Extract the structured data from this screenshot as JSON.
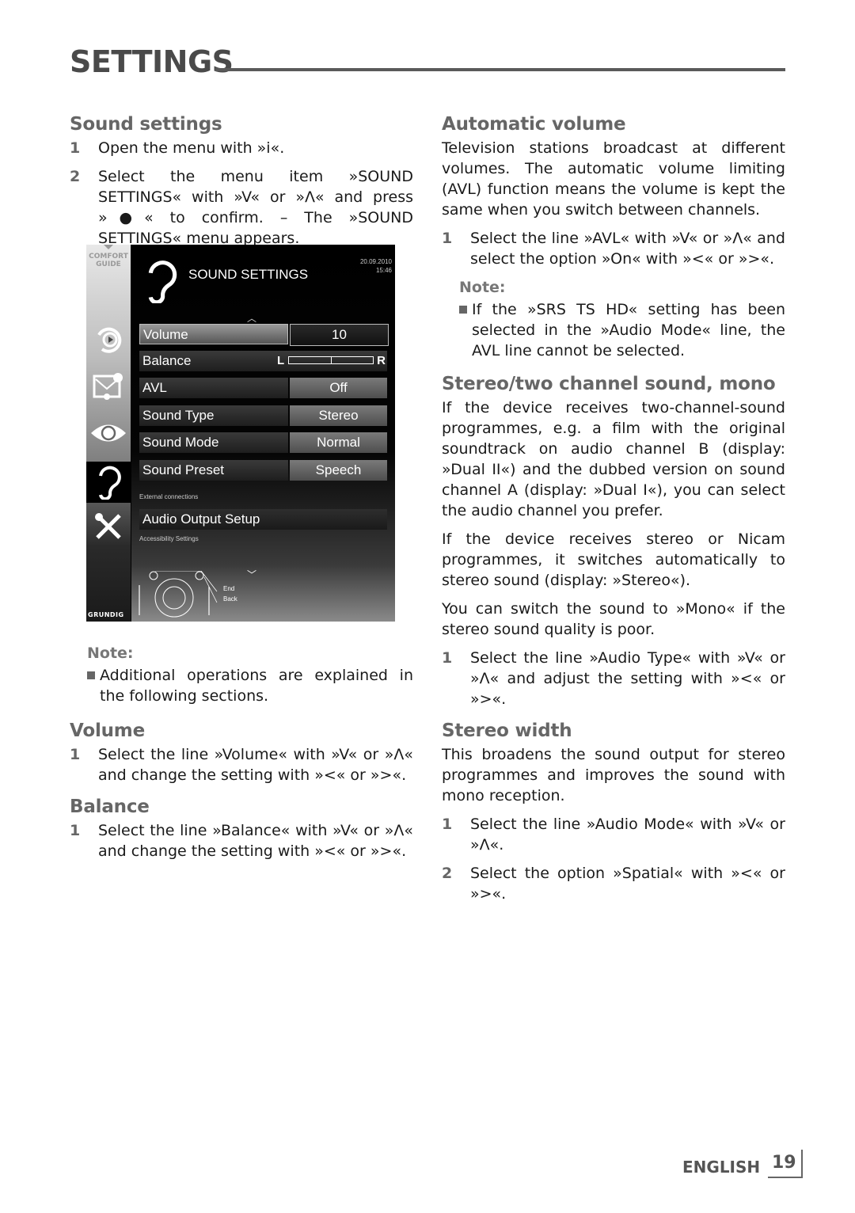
{
  "page": {
    "title": "SETTINGS",
    "footer_language": "ENGLISH",
    "page_number": "19"
  },
  "left": {
    "sound_settings": {
      "heading": "Sound settings",
      "steps": [
        {
          "num": "1",
          "text": "Open the menu with »i«."
        },
        {
          "num": "2",
          "text": "Select the menu item »SOUND SETTINGS« with »V« or »Λ« and press »●« to confirm. – The »SOUND SETTINGS« menu appears."
        }
      ]
    },
    "note": {
      "title": "Note:",
      "items": [
        "Additional operations are explained in the following sections."
      ]
    },
    "volume": {
      "heading": "Volume",
      "steps": [
        {
          "num": "1",
          "text": "Select the line »Volume« with »V« or »Λ« and change the setting with »<« or »>«."
        }
      ]
    },
    "balance": {
      "heading": "Balance",
      "steps": [
        {
          "num": "1",
          "text": "Select the line »Balance« with »V« or »Λ« and change the setting with »<« or »>«."
        }
      ]
    }
  },
  "tv_menu": {
    "comfort_guide": "COMFORT GUIDE",
    "title": "SOUND SETTINGS",
    "date": "20.09.2010",
    "time": "15:46",
    "brand": "GRUNDIG",
    "rows": [
      {
        "label": "Volume",
        "value": "10",
        "selected": true
      },
      {
        "label": "Balance",
        "value": "",
        "balance_left": "L",
        "balance_right": "R",
        "balance_position": 0.5
      },
      {
        "label": "AVL",
        "value": "Off"
      },
      {
        "label": "Sound Type",
        "value": "Stereo"
      },
      {
        "label": "Sound Mode",
        "value": "Normal"
      },
      {
        "label": "Sound Preset",
        "value": "Speech"
      }
    ],
    "external_connections": "External connections",
    "audio_output_setup": "Audio Output Setup",
    "accessibility_settings": "Accessibility Settings",
    "legend_end": "End",
    "legend_back": "Back",
    "side_icons": [
      "source-icon",
      "connections-icon",
      "picture-icon",
      "sound-icon",
      "tools-icon"
    ]
  },
  "right": {
    "automatic_volume": {
      "heading": "Automatic volume",
      "para": "Television stations broadcast at different volumes. The automatic volume limiting (AVL) function means the volume is kept the same when you switch between channels.",
      "steps": [
        {
          "num": "1",
          "text": "Select the line »AVL« with »V« or »Λ« and select the option »On« with »<« or »>«."
        }
      ],
      "note_title": "Note:",
      "note_items": [
        "If the »SRS TS HD« setting has been selected in the »Audio Mode« line, the AVL line cannot be selected."
      ]
    },
    "stereo": {
      "heading": "Stereo/two channel sound, mono",
      "paras": [
        "If the device receives two-channel-sound programmes, e.g. a film with the original soundtrack on audio channel B (display: »Dual II«) and the dubbed version on sound channel A (display: »Dual I«), you can select the audio channel you prefer.",
        "If the device receives stereo or Nicam programmes, it switches automatically to stereo sound (display: »Stereo«).",
        "You can switch the sound to »Mono« if the stereo sound quality is poor."
      ],
      "steps": [
        {
          "num": "1",
          "text": "Select the line »Audio Type« with »V« or »Λ« and adjust the setting with »<« or »>«."
        }
      ]
    },
    "stereo_width": {
      "heading": "Stereo width",
      "para": "This broadens the sound output for stereo programmes and improves the sound with mono reception.",
      "steps": [
        {
          "num": "1",
          "text": "Select the line »Audio Mode« with »V« or »Λ«."
        },
        {
          "num": "2",
          "text": "Select the option »Spatial« with »<« or »>«."
        }
      ]
    }
  }
}
